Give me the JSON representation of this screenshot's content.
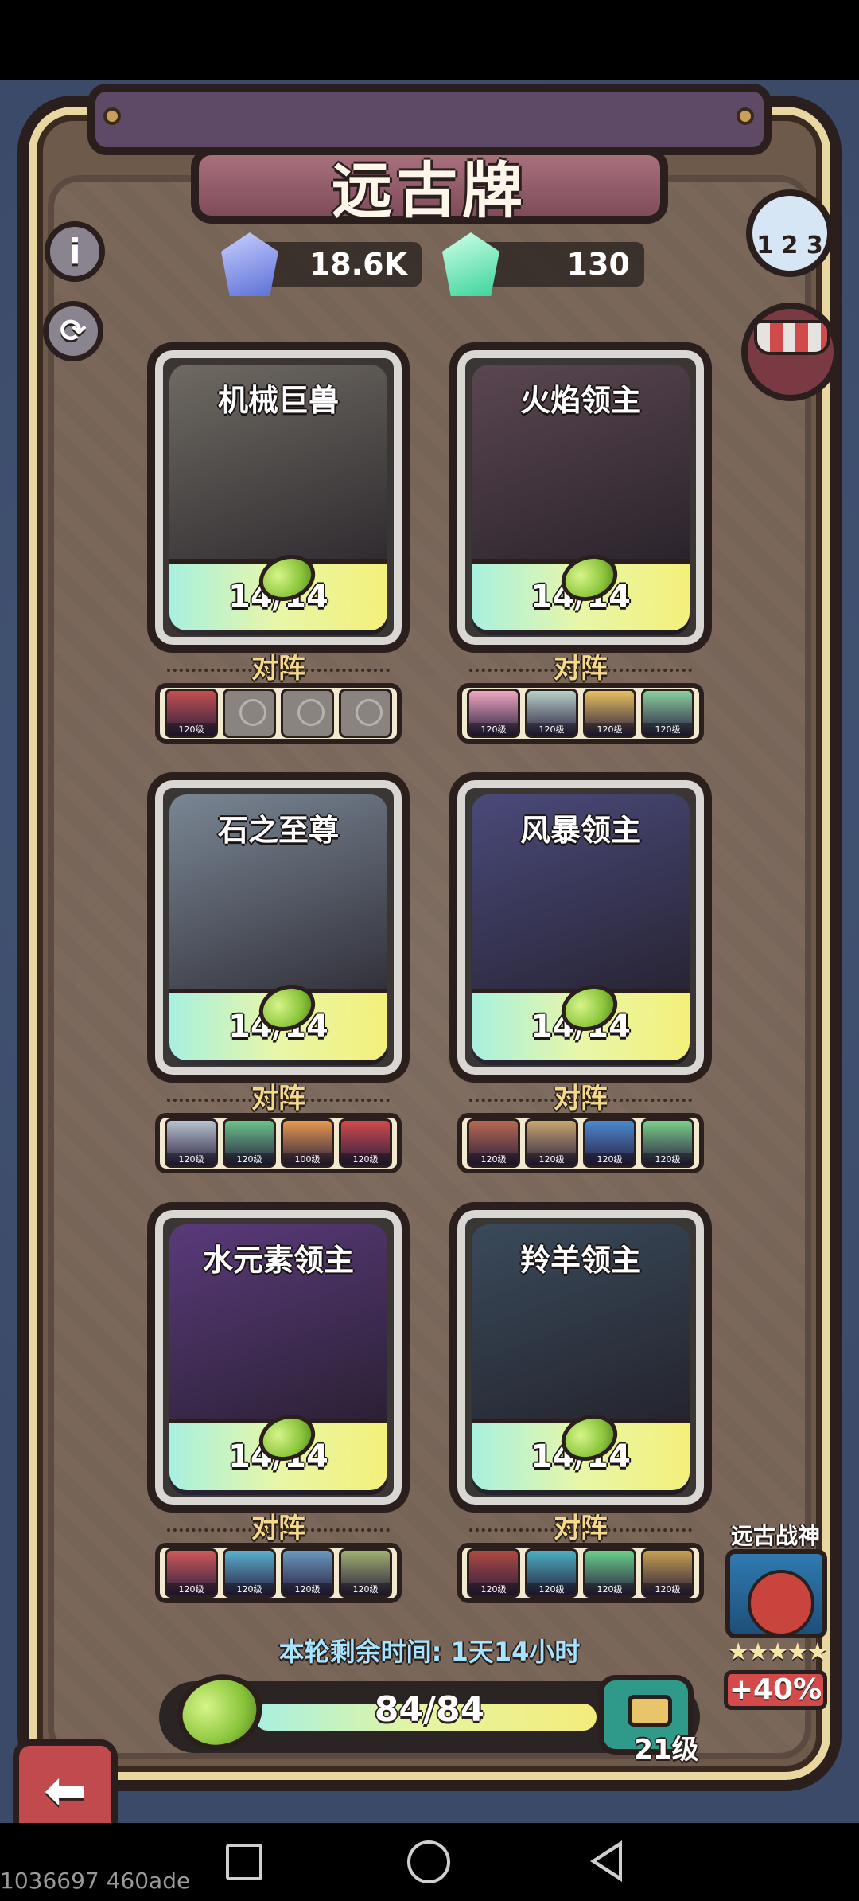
{
  "header": {
    "title": "远古牌",
    "info_label": "i"
  },
  "currencies": [
    {
      "name": "blue-crystal",
      "value": "18.6K",
      "color": "#5b6fd6"
    },
    {
      "name": "green-crystal",
      "value": "130",
      "color": "#3bd49a"
    }
  ],
  "cards": [
    {
      "name": "机械巨兽",
      "progress": "14/14",
      "art_color": "#6f6a62",
      "team_label": "对阵",
      "team": [
        {
          "lv": "120级",
          "empty": false,
          "color": "#c45050"
        },
        {
          "empty": true
        },
        {
          "empty": true
        },
        {
          "empty": true
        }
      ]
    },
    {
      "name": "火焰领主",
      "progress": "14/14",
      "art_color": "#5a4650",
      "team_label": "对阵",
      "team": [
        {
          "lv": "120级",
          "color": "#f0a8c0"
        },
        {
          "lv": "120级",
          "color": "#b8d0c8"
        },
        {
          "lv": "120级",
          "color": "#e8c060"
        },
        {
          "lv": "120级",
          "color": "#8ad0a0"
        }
      ]
    },
    {
      "name": "石之至尊",
      "progress": "14/14",
      "art_color": "#7a8694",
      "team_label": "对阵",
      "team": [
        {
          "lv": "120级",
          "color": "#b8c4d0"
        },
        {
          "lv": "120级",
          "color": "#6ac48a"
        },
        {
          "lv": "100级",
          "color": "#e89a50"
        },
        {
          "lv": "120级",
          "color": "#d04a4a"
        }
      ]
    },
    {
      "name": "风暴领主",
      "progress": "14/14",
      "art_color": "#4a4a7a",
      "team_label": "对阵",
      "team": [
        {
          "lv": "120级",
          "color": "#b86a50"
        },
        {
          "lv": "120级",
          "color": "#c8a870"
        },
        {
          "lv": "120级",
          "color": "#4a8ad0"
        },
        {
          "lv": "120级",
          "color": "#7ad08a"
        }
      ]
    },
    {
      "name": "水元素领主",
      "progress": "14/14",
      "art_color": "#5a3a7a",
      "team_label": "对阵",
      "team": [
        {
          "lv": "120级",
          "color": "#d05a5a"
        },
        {
          "lv": "120级",
          "color": "#5ab0d0"
        },
        {
          "lv": "120级",
          "color": "#6a9ac0"
        },
        {
          "lv": "120级",
          "color": "#a0b070"
        }
      ]
    },
    {
      "name": "羚羊领主",
      "progress": "14/14",
      "art_color": "#3a4a5a",
      "team_label": "对阵",
      "team": [
        {
          "lv": "120级",
          "color": "#b04a40"
        },
        {
          "lv": "120级",
          "color": "#4ab0c0"
        },
        {
          "lv": "120级",
          "color": "#6ad08a"
        },
        {
          "lv": "120级",
          "color": "#c8a050"
        }
      ]
    }
  ],
  "footer": {
    "timer_text": "本轮剩余时间: 1天14小时",
    "progress_text": "84/84",
    "progress_fraction": 1.0,
    "chest_level": "21级"
  },
  "bonus": {
    "title": "远古战神",
    "stars": "★★★★★",
    "percent": "+40%"
  },
  "system": {
    "watermark": "1036697 460ade"
  }
}
